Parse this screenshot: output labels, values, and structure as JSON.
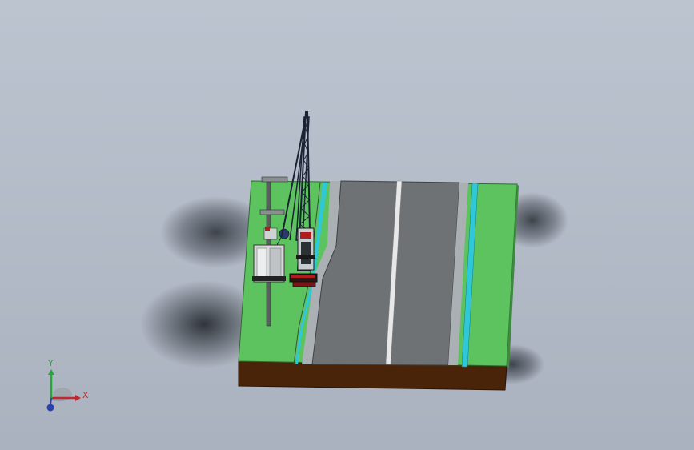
{
  "viewport": {
    "background_top": "#bcc4d0",
    "background_bottom": "#aab2bf"
  },
  "scene": {
    "grass_color": "#5cc35e",
    "soil_color": "#4a2408",
    "road_color": "#6e7275",
    "curb_color": "#aab0b3",
    "lane_marking_color": "#e8e8e8",
    "water_channel_color": "#2fc8d8",
    "crane_color": "#1b2335",
    "accent_red": "#b01d1d"
  },
  "triad": {
    "x_label": "X",
    "y_label": "Y",
    "x_color": "#c2272d",
    "y_color": "#25a53a",
    "z_color": "#2a3fb0"
  }
}
